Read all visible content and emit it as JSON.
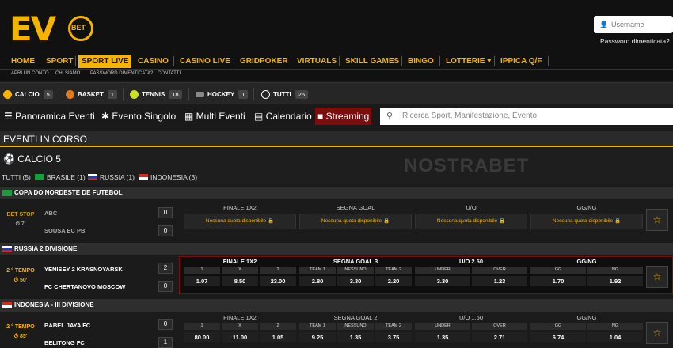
{
  "brand": {
    "ev": "EV",
    "bet": "BET"
  },
  "login": {
    "username_placeholder": "Username",
    "forgot": "Password dimenticata?"
  },
  "nav": [
    "HOME",
    "SPORT",
    "SPORT LIVE",
    "CASINO",
    "CASINO LIVE",
    "GRIDPOKER",
    "VIRTUALS",
    "SKILL GAMES",
    "BINGO",
    "LOTTERIE ▾",
    "IPPICA Q/F"
  ],
  "subnav": [
    "APRI UN CONTO",
    "CHI SIAMO",
    "PASSWORD DIMENTICATA?",
    "CONTATTI"
  ],
  "sports": [
    {
      "label": "CALCIO",
      "count": "5",
      "color": "#f5b400"
    },
    {
      "label": "BASKET",
      "count": "1",
      "color": "#e07a1f"
    },
    {
      "label": "TENNIS",
      "count": "18",
      "color": "#c8e01f"
    },
    {
      "label": "HOCKEY",
      "count": "1",
      "color": "#888888"
    },
    {
      "label": "TUTTI",
      "count": "25",
      "color": "#ffffff"
    }
  ],
  "tabs": [
    "Panoramica Eventi",
    "Evento Singolo",
    "Multi Eventi",
    "Calendario",
    "Streaming"
  ],
  "search_placeholder": "Ricerca Sport, Manifestazione, Evento",
  "section_title": "EVENTI IN CORSO",
  "calcio_title": "CALCIO 5",
  "watermark": "NOSTRABET",
  "filters": [
    "TUTTI (5)",
    "BRASILE (1)",
    "RUSSIA (1)",
    "INDONESIA (3)"
  ],
  "groups": [
    {
      "name": "COPA DO NORDESTE DE FUTEBOL"
    },
    {
      "name": "RUSSIA 2 DIVISIONE"
    },
    {
      "name": "INDONESIA - III DIVISIONE"
    }
  ],
  "match1": {
    "status": "BET STOP",
    "time": "⏱ 7'",
    "home": "ABC",
    "away": "SOUSA EC PB",
    "home_score": "0",
    "away_score": "0",
    "markets": [
      "FINALE 1X2",
      "SEGNA GOAL",
      "U/O",
      "GG/NG"
    ],
    "no_odds": "Nessuna quota disponibile 🔒"
  },
  "match2": {
    "status": "2 ° TEMPO",
    "time": "⏱ 50'",
    "home": "YENISEY 2 KRASNOYARSK",
    "away": "FC CHERTANOVO MOSCOW",
    "home_score": "2",
    "away_score": "0",
    "markets": [
      {
        "title": "FINALE 1X2",
        "labels": [
          "1",
          "X",
          "2"
        ],
        "odds": [
          "1.07",
          "8.50",
          "23.00"
        ]
      },
      {
        "title": "SEGNA GOAL 3",
        "labels": [
          "TEAM 1",
          "NESSUNO",
          "TEAM 2"
        ],
        "odds": [
          "2.80",
          "3.30",
          "2.20"
        ]
      },
      {
        "title": "U/O 2.50",
        "labels": [
          "UNDER",
          "OVER"
        ],
        "odds": [
          "3.30",
          "1.23"
        ]
      },
      {
        "title": "GG/NG",
        "labels": [
          "GG",
          "NG"
        ],
        "odds": [
          "1.70",
          "1.92"
        ]
      }
    ]
  },
  "match3": {
    "status": "2 ° TEMPO",
    "time": "⏱ 85'",
    "home": "BABEL JAYA FC",
    "away": "BELITONG FC",
    "home_score": "0",
    "away_score": "1",
    "markets": [
      {
        "title": "FINALE 1X2",
        "labels": [
          "1",
          "X",
          "2"
        ],
        "odds": [
          "80.00",
          "11.00",
          "1.05"
        ]
      },
      {
        "title": "SEGNA GOAL 2",
        "labels": [
          "TEAM 1",
          "NESSUNO",
          "TEAM 2"
        ],
        "odds": [
          "9.25",
          "1.35",
          "3.75"
        ]
      },
      {
        "title": "U/O 1.50",
        "labels": [
          "UNDER",
          "OVER"
        ],
        "odds": [
          "1.35",
          "2.71"
        ]
      },
      {
        "title": "GG/NG",
        "labels": [
          "GG",
          "NG"
        ],
        "odds": [
          "6.74",
          "1.04"
        ]
      }
    ]
  }
}
